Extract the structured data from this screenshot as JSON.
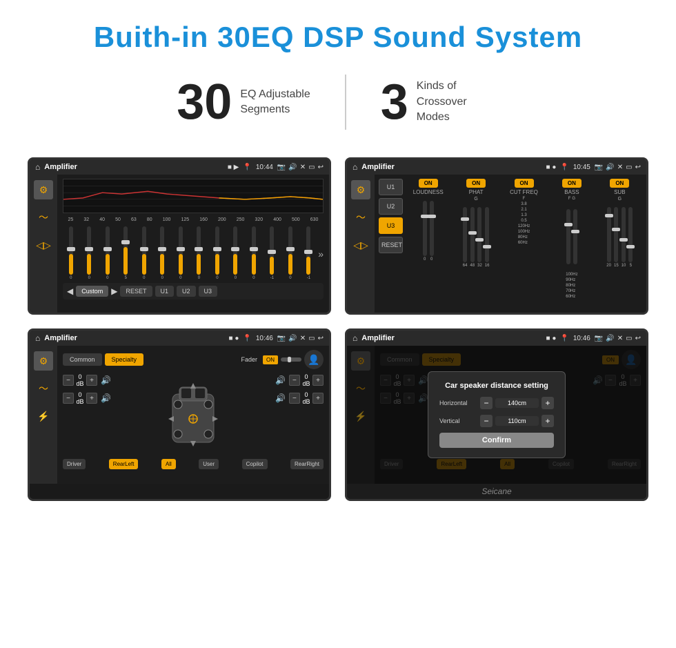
{
  "header": {
    "title": "Buith-in 30EQ DSP Sound System"
  },
  "stats": {
    "eq_number": "30",
    "eq_label_line1": "EQ Adjustable",
    "eq_label_line2": "Segments",
    "crossover_number": "3",
    "crossover_label_line1": "Kinds of",
    "crossover_label_line2": "Crossover Modes"
  },
  "screen1": {
    "status_title": "Amplifier",
    "time": "10:44",
    "eq_freqs": [
      "25",
      "32",
      "40",
      "50",
      "63",
      "80",
      "100",
      "125",
      "160",
      "200",
      "250",
      "320",
      "400",
      "500",
      "630"
    ],
    "eq_values": [
      "0",
      "0",
      "0",
      "5",
      "0",
      "0",
      "0",
      "0",
      "0",
      "0",
      "0",
      "-1",
      "0",
      "-1"
    ],
    "bottom_labels": [
      "Custom",
      "RESET",
      "U1",
      "U2",
      "U3"
    ]
  },
  "screen2": {
    "status_title": "Amplifier",
    "time": "10:45",
    "presets": [
      "U1",
      "U2",
      "U3"
    ],
    "active_preset": "U3",
    "channels": [
      "LOUDNESS",
      "PHAT",
      "CUT FREQ",
      "BASS",
      "SUB"
    ],
    "reset_label": "RESET"
  },
  "screen3": {
    "status_title": "Amplifier",
    "time": "10:46",
    "tabs": [
      "Common",
      "Specialty"
    ],
    "active_tab": "Specialty",
    "fader_label": "Fader",
    "fader_on": "ON",
    "db_values": [
      "0 dB",
      "0 dB",
      "0 dB",
      "0 dB"
    ],
    "bottom_btns": [
      "Driver",
      "RearLeft",
      "All",
      "User",
      "Copilot",
      "RearRight"
    ]
  },
  "screen4": {
    "status_title": "Amplifier",
    "time": "10:46",
    "tabs": [
      "Common",
      "Specialty"
    ],
    "active_tab": "Specialty",
    "dialog": {
      "title": "Car speaker distance setting",
      "horizontal_label": "Horizontal",
      "horizontal_value": "140cm",
      "vertical_label": "Vertical",
      "vertical_value": "110cm",
      "confirm_label": "Confirm"
    },
    "db_values": [
      "0 dB",
      "0 dB"
    ],
    "bottom_btns": [
      "Driver",
      "RearLeft",
      "All",
      "Copilot",
      "RearRight"
    ]
  },
  "watermark": "Seicane"
}
